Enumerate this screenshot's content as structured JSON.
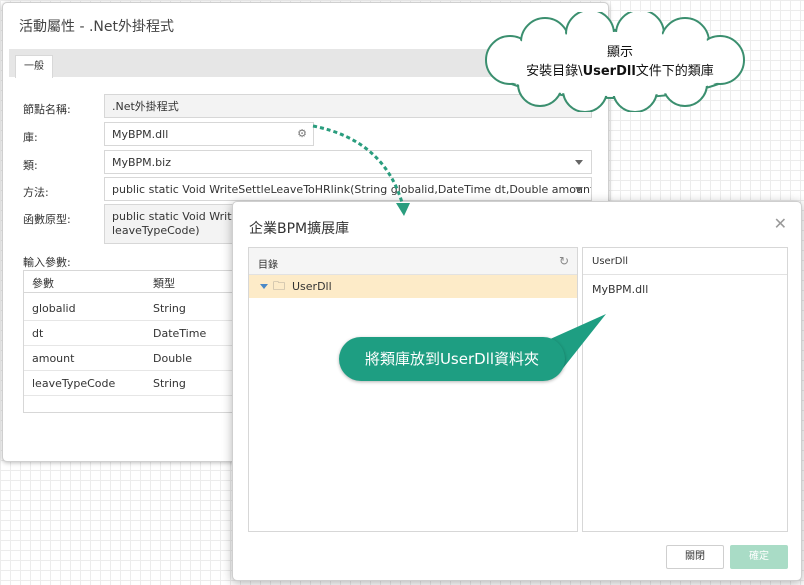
{
  "prop_window": {
    "title": "活動屬性 - .Net外掛程式",
    "tab_general": "一般",
    "node_name_label": "節點名稱:",
    "node_name_value": ".Net外掛程式",
    "library_label": "庫:",
    "library_value": "MyBPM.dll",
    "class_label": "類:",
    "class_value": "MyBPM.biz",
    "method_label": "方法:",
    "method_value": "public static Void WriteSettleLeaveToHRlink(String globalid,DateTime dt,Double amount,String",
    "prototype_label": "函數原型:",
    "prototype_line1": "public static Void WriteSettleLeaveToHRlink(String globalid,DateTime dt,Double amount,String",
    "prototype_line2": "leaveTypeCode)",
    "input_params_label": "輸入參數:",
    "params": {
      "headers": [
        "參數",
        "類型"
      ],
      "rows": [
        [
          "globalid",
          "String"
        ],
        [
          "dt",
          "DateTime"
        ],
        [
          "amount",
          "Double"
        ],
        [
          "leaveTypeCode",
          "String"
        ]
      ]
    }
  },
  "cloud_note": {
    "line1": "顯示",
    "line2_prefix": "安裝目錄\\",
    "line2_bold": "UserDll",
    "line2_suffix": "文件下的類庫"
  },
  "library_dialog": {
    "title": "企業BPM擴展庫",
    "dir_header": "目錄",
    "tree_folder": "UserDll",
    "files_header": "UserDll",
    "file_item": "MyBPM.dll",
    "close_button": "關閉",
    "ok_button": "確定"
  },
  "callout_note": "將類庫放到UserDll資料夾",
  "colors": {
    "callout_bg": "#1e9e82",
    "arrow": "#2a9d7e",
    "tree_selected": "#fdebc8",
    "ok_button": "#a9dcc6"
  }
}
